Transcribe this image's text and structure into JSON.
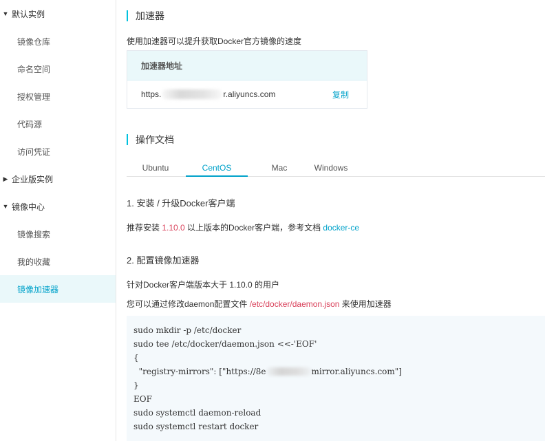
{
  "sidebar": {
    "groups": [
      {
        "label": "默认实例",
        "caret": "▼",
        "expanded": true,
        "items": [
          "镜像仓库",
          "命名空间",
          "授权管理",
          "代码源",
          "访问凭证"
        ]
      },
      {
        "label": "企业版实例",
        "caret": "▶",
        "expanded": false,
        "items": []
      },
      {
        "label": "镜像中心",
        "caret": "▼",
        "expanded": true,
        "items": [
          "镜像搜索",
          "我的收藏",
          "镜像加速器"
        ]
      }
    ],
    "active_item": "镜像加速器"
  },
  "accelerator": {
    "title": "加速器",
    "description": "使用加速器可以提升获取Docker官方镜像的速度",
    "table_header": "加速器地址",
    "url_prefix": "https.",
    "url_suffix": "r.aliyuncs.com",
    "copy_label": "复制"
  },
  "docs": {
    "title": "操作文档",
    "tabs": [
      "Ubuntu",
      "CentOS",
      "Mac",
      "Windows"
    ],
    "active_tab": "CentOS",
    "step1": {
      "title": "1. 安装 / 升级Docker客户端",
      "text_before": "推荐安装 ",
      "version": "1.10.0",
      "text_after": " 以上版本的Docker客户端，参考文档 ",
      "link": "docker-ce"
    },
    "step2": {
      "title": "2. 配置镜像加速器",
      "line1": "针对Docker客户端版本大于 1.10.0 的用户",
      "line2_before": "您可以通过修改daemon配置文件 ",
      "line2_path": "/etc/docker/daemon.json",
      "line2_after": " 来使用加速器"
    },
    "code": {
      "l1": "sudo mkdir -p /etc/docker",
      "l2": "sudo tee /etc/docker/daemon.json <<-'EOF'",
      "l3": "{",
      "l4_before": "  \"registry-mirrors\": [\"https://8e",
      "l4_after": "mirror.aliyuncs.com\"]",
      "l5": "}",
      "l6": "EOF",
      "l7": "sudo systemctl daemon-reload",
      "l8": "sudo systemctl restart docker"
    }
  },
  "colors": {
    "accent": "#00a2ca",
    "title_bar": "#00c1de",
    "active_bg": "#eaf8fa",
    "highlight_red": "#d9405a",
    "code_bg": "#f4f9fc"
  }
}
